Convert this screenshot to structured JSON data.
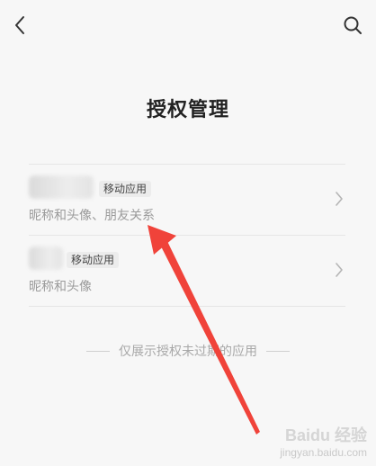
{
  "header": {
    "back_icon": "chevron-left-icon",
    "search_icon": "search-icon"
  },
  "page": {
    "title": "授权管理"
  },
  "items": [
    {
      "badge": "移动应用",
      "permissions": "昵称和头像、朋友关系"
    },
    {
      "badge": "移动应用",
      "permissions": "昵称和头像"
    }
  ],
  "footer": {
    "note": "仅展示授权未过期的应用"
  },
  "watermark": {
    "brand": "Baidu 经验",
    "site": "jingyan.baidu.com"
  },
  "colors": {
    "background": "#f7f7f7",
    "annotation_arrow": "#f0433a",
    "title": "#222222",
    "secondary_text": "#9a9a9a"
  }
}
